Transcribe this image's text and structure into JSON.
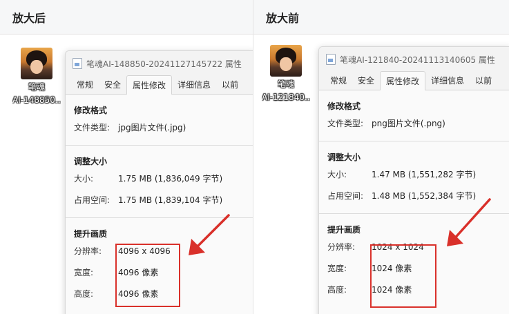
{
  "headers": {
    "left": "放大后",
    "right": "放大前"
  },
  "colors": {
    "highlight": "#d9302a",
    "arrow": "#d9302a"
  },
  "left": {
    "icon_name": "icon-portrait-thumbnail",
    "file_label_line1": "笔魂",
    "file_label_line2": "AI-148850...",
    "dialog_title": "笔魂AI-148850-20241127145722 属性",
    "tabs": [
      "常规",
      "安全",
      "属性修改",
      "详细信息",
      "以前"
    ],
    "active_tab": "属性修改",
    "format_section": "修改格式",
    "file_type_label": "文件类型:",
    "file_type_value": "jpg图片文件(.jpg)",
    "size_section": "调整大小",
    "size_label": "大小:",
    "size_value": "1.75 MB (1,836,049 字节)",
    "disk_label": "占用空间:",
    "disk_value": "1.75 MB (1,839,104 字节)",
    "quality_section": "提升画质",
    "resolution_label": "分辨率:",
    "resolution_value": "4096 x 4096",
    "width_label": "宽度:",
    "width_value": "4096 像素",
    "height_label": "高度:",
    "height_value": "4096 像素"
  },
  "right": {
    "icon_name": "icon-portrait-thumbnail",
    "file_label_line1": "笔魂",
    "file_label_line2": "AI-121840...",
    "dialog_title": "笔魂AI-121840-20241113140605 属性",
    "tabs": [
      "常规",
      "安全",
      "属性修改",
      "详细信息",
      "以前"
    ],
    "active_tab": "属性修改",
    "format_section": "修改格式",
    "file_type_label": "文件类型:",
    "file_type_value": "png图片文件(.png)",
    "size_section": "调整大小",
    "size_label": "大小:",
    "size_value": "1.47 MB (1,551,282 字节)",
    "disk_label": "占用空间:",
    "disk_value": "1.48 MB (1,552,384 字节)",
    "quality_section": "提升画质",
    "resolution_label": "分辨率:",
    "resolution_value": "1024 x 1024",
    "width_label": "宽度:",
    "width_value": "1024 像素",
    "height_label": "高度:",
    "height_value": "1024 像素"
  }
}
